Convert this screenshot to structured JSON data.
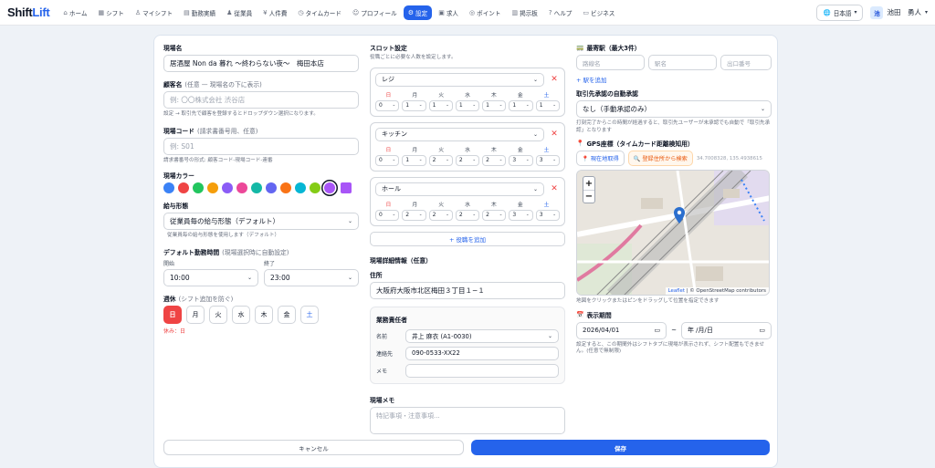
{
  "app": {
    "logo_a": "Shift",
    "logo_b": "Lift"
  },
  "nav": [
    {
      "icon": "⌂",
      "label": "ホーム"
    },
    {
      "icon": "▦",
      "label": "シフト"
    },
    {
      "icon": "♙",
      "label": "マイシフト"
    },
    {
      "icon": "▤",
      "label": "勤務実績"
    },
    {
      "icon": "♟",
      "label": "従業員"
    },
    {
      "icon": "¥",
      "label": "人件費"
    },
    {
      "icon": "◷",
      "label": "タイムカード"
    },
    {
      "icon": "☺",
      "label": "プロフィール"
    },
    {
      "icon": "⚙",
      "label": "設定"
    },
    {
      "icon": "▣",
      "label": "求人"
    },
    {
      "icon": "◎",
      "label": "ポイント"
    },
    {
      "icon": "▥",
      "label": "掲示板"
    },
    {
      "icon": "?",
      "label": "ヘルプ"
    },
    {
      "icon": "▭",
      "label": "ビジネス"
    }
  ],
  "lang": "日本語",
  "user": {
    "avatar": "池",
    "name": "池田　勇人"
  },
  "form": {
    "site_name_label": "現場名",
    "site_name": "居酒屋 Non da 暮れ 〜終わらない夜〜　梅田本店",
    "client_label": "顧客名",
    "client_sub": "(任意 — 現場名の下に表示)",
    "client_placeholder": "例: 〇〇株式会社 渋谷店",
    "client_help": "設定 → 取引先で顧客を登録するとドロップダウン選択になります。",
    "code_label": "現場コード",
    "code_sub": "(請求書番号用、任意)",
    "code_placeholder": "例: S01",
    "code_help": "請求書番号の形式: 顧客コード-現場コード-連番",
    "color_label": "現場カラー",
    "colors": [
      "#3b82f6",
      "#ef4444",
      "#22c55e",
      "#f59e0b",
      "#8b5cf6",
      "#ec4899",
      "#14b8a6",
      "#6366f1",
      "#f97316",
      "#06b6d4",
      "#84cc16",
      "#a855f7"
    ],
    "pay_label": "給与形態",
    "pay_value": "従業員毎の給与形態（デフォルト）",
    "pay_help": "従業員毎の給与形態を使用します（デフォルト）",
    "time_label": "デフォルト勤務時間",
    "time_sub": "(現場選択時に自動設定)",
    "start_label": "開始",
    "start_value": "10:00",
    "end_label": "終了",
    "end_value": "23:00",
    "holiday_label": "週休",
    "holiday_sub": "(シフト追加を防ぐ)",
    "days": [
      "日",
      "月",
      "火",
      "水",
      "木",
      "金",
      "土"
    ],
    "holiday_note": "休み：日"
  },
  "slots": {
    "label": "スロット設定",
    "help": "役職ごとに必要な人数を設定します。",
    "weekdays": [
      "日",
      "月",
      "火",
      "水",
      "木",
      "金",
      "土"
    ],
    "items": [
      {
        "role": "レジ",
        "counts": [
          "0",
          "1",
          "1",
          "1",
          "1",
          "1",
          "1"
        ]
      },
      {
        "role": "キッチン",
        "counts": [
          "0",
          "1",
          "2",
          "2",
          "2",
          "3",
          "3"
        ]
      },
      {
        "role": "ホール",
        "counts": [
          "0",
          "2",
          "2",
          "2",
          "2",
          "3",
          "3"
        ]
      }
    ],
    "add_role": "+ 役職を追加"
  },
  "detail": {
    "label": "現場詳細情報（任意）",
    "address_label": "住所",
    "address": "大阪府大阪市北区梅田３丁目１−１",
    "manager_label": "業務責任者",
    "name_label": "名前",
    "name_value": "井上 麻衣 (A1-0030)",
    "contact_label": "連絡先",
    "contact_value": "090-0533-XX22",
    "memo_label": "メモ",
    "memo_value": "",
    "site_memo_label": "現場メモ",
    "site_memo_placeholder": "特記事項・注意事項..."
  },
  "access": {
    "station_label": "最寄駅（最大3件）",
    "route_placeholder": "路線名",
    "station_placeholder": "駅名",
    "exit_placeholder": "出口番号",
    "add_station": "+ 駅を追加",
    "approval_label": "取引先承認の自動承認",
    "approval_value": "なし（手動承認のみ）",
    "approval_help": "打刻完了からこの時間が経過すると、取引先ユーザーが未承認でも自動で「取引先承認」となります",
    "gps_label": "GPS座標（タイムカード距離検知用）",
    "btn_current": "現在地取得",
    "btn_search": "登録住所から検索",
    "coords": "34.7008328, 135.4938615",
    "map_attr_leaflet": "Leaflet",
    "map_attr_rest": "| © OpenStreetMap contributors",
    "map_help": "地図をクリックまたはピンをドラッグして位置を指定できます",
    "period_label": "表示期間",
    "start_date": "2026/04/01",
    "end_date": "年 /月/日",
    "period_help": "設定すると、この期間外はシフトタブに現場が表示されず、シフト配置もできません。(任意で無制限)"
  },
  "footer": {
    "cancel": "キャンセル",
    "save": "保存"
  }
}
